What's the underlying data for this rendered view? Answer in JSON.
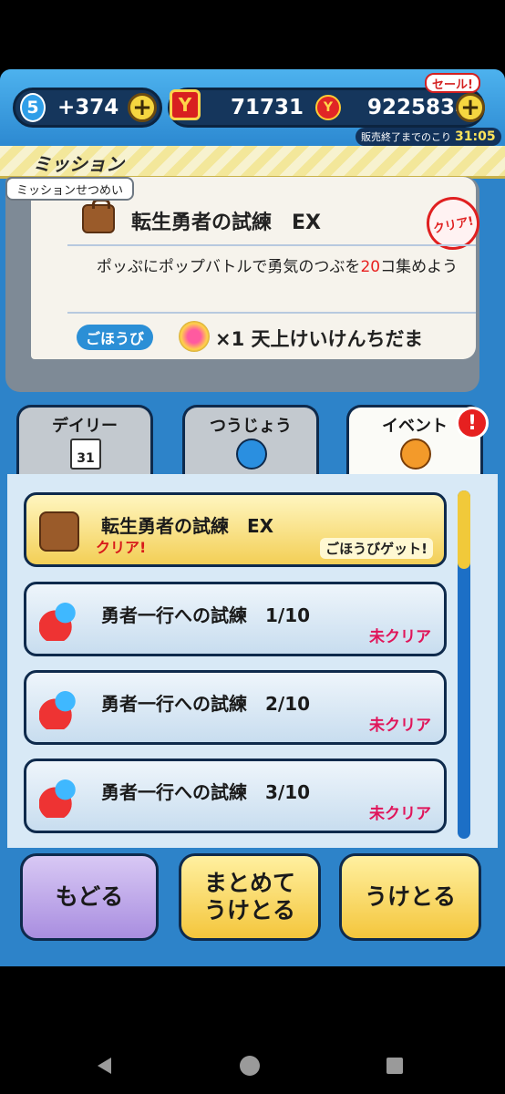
{
  "topbar": {
    "level": "5",
    "stamina": "+374",
    "money": "71731",
    "coins": "9225834",
    "sale_label": "セール!",
    "timer_label": "販売終了までのこり",
    "timer_value": "31:05"
  },
  "mission_header": {
    "label": "ミッション"
  },
  "mission_detail": {
    "tab_label": "ミッションせつめい",
    "title": "転生勇者の試練　EX",
    "desc_before": "ポッぷにポップバトルで勇気のつぶを",
    "desc_highlight": "20",
    "desc_after": "コ集めよう",
    "reward_label": "ごほうび",
    "reward_count": "×1",
    "reward_name": "天上けいけんちだま",
    "stamp": "クリア!"
  },
  "tabs": [
    {
      "label": "デイリー",
      "icon": "calendar-icon",
      "icon_text": "31"
    },
    {
      "label": "つうじょう",
      "icon": "flag-icon"
    },
    {
      "label": "イベント",
      "icon": "event-flag-icon"
    }
  ],
  "alert_mark": "!",
  "missions": [
    {
      "title": "転生勇者の試練　EX",
      "status": "クリア!",
      "reward_status": "ごほうびゲット!"
    },
    {
      "title": "勇者一行への試練　1/10",
      "status": "未クリア"
    },
    {
      "title": "勇者一行への試練　2/10",
      "status": "未クリア"
    },
    {
      "title": "勇者一行への試練　3/10",
      "status": "未クリア"
    }
  ],
  "buttons": {
    "back": "もどる",
    "collect_all_line1": "まとめて",
    "collect_all_line2": "うけとる",
    "collect": "うけとる"
  },
  "colors": {
    "accent_blue": "#2d83c9",
    "highlight_red": "#e8201e",
    "uncleared_pink": "#e0155a",
    "gold": "#f4c63c"
  }
}
